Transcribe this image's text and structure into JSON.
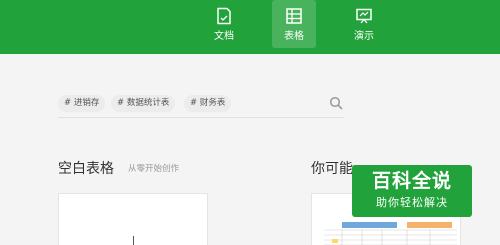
{
  "header": {
    "tabs": [
      {
        "label": "文档",
        "icon": "document-icon",
        "active": false
      },
      {
        "label": "表格",
        "icon": "table-icon",
        "active": true
      },
      {
        "label": "演示",
        "icon": "presentation-icon",
        "active": false
      }
    ],
    "accent_color": "#22a23a"
  },
  "search": {
    "tags": [
      "# 进销存",
      "# 数据统计表",
      "# 财务表"
    ],
    "icon": "search-icon"
  },
  "sections": {
    "blank_title": "空白表格",
    "blank_subtitle": "从零开始创作",
    "suggest_title": "你可能"
  },
  "watermark": {
    "title": "百科全说",
    "subtitle": "助你轻松解决"
  }
}
